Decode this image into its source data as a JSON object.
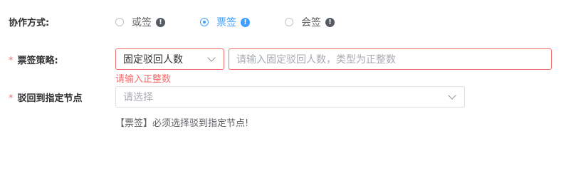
{
  "collab": {
    "label": "协作方式:",
    "options": [
      {
        "label": "或签",
        "info_icon": "info-icon",
        "checked": false
      },
      {
        "label": "票签",
        "info_icon": "info-icon",
        "checked": true
      },
      {
        "label": "会签",
        "info_icon": "info-icon",
        "checked": false
      }
    ]
  },
  "strategy": {
    "required_mark": "*",
    "label": "票签策略:",
    "select_value": "固定驳回人数",
    "input_placeholder": "请输入固定驳回人数，类型为正整数",
    "error": "请输入正整数"
  },
  "reject_node": {
    "required_mark": "*",
    "label": "驳回到指定节点",
    "select_placeholder": "请选择",
    "tip": "【票签】必须选择驳到指定节点!"
  },
  "colors": {
    "primary": "#409eff",
    "error": "#f56c6c",
    "icon_dark": "#555a63"
  }
}
